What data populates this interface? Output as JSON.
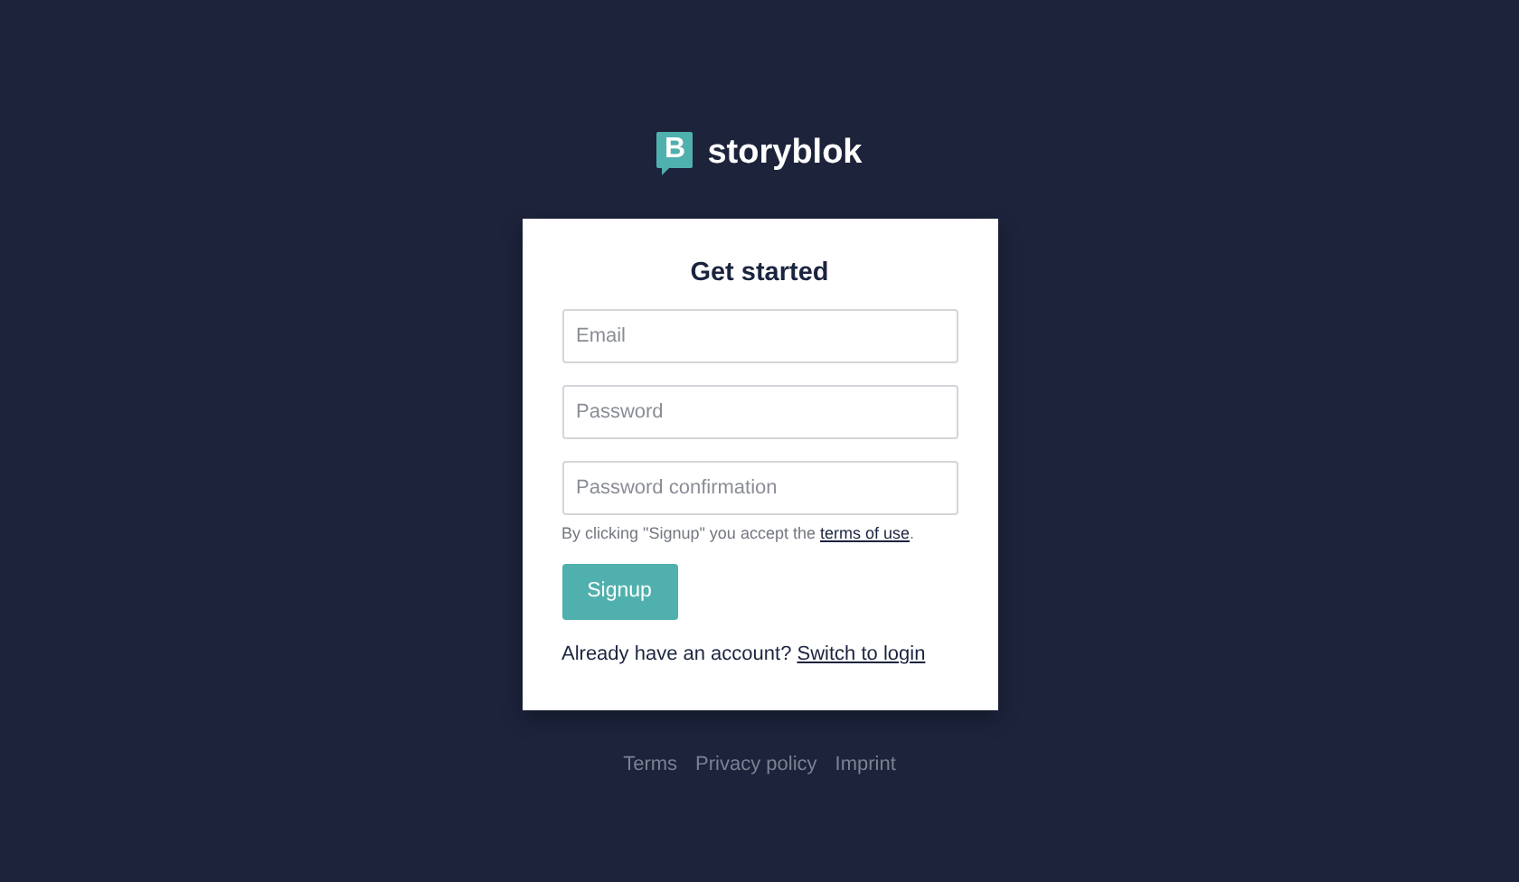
{
  "logo": {
    "mark": "B",
    "name": "storyblok"
  },
  "form": {
    "title": "Get started",
    "fields": [
      {
        "placeholder": "Email"
      },
      {
        "placeholder": "Password"
      },
      {
        "placeholder": "Password confirmation"
      }
    ],
    "terms_note": {
      "text": "By clicking \"Signup\" you accept the ",
      "link": "terms of use",
      "after": "."
    },
    "submit": "Signup",
    "switch_note": {
      "text": "Already have an account? ",
      "link": "Switch to login"
    }
  },
  "footer_links": [
    "Terms",
    "Privacy policy",
    "Imprint"
  ]
}
